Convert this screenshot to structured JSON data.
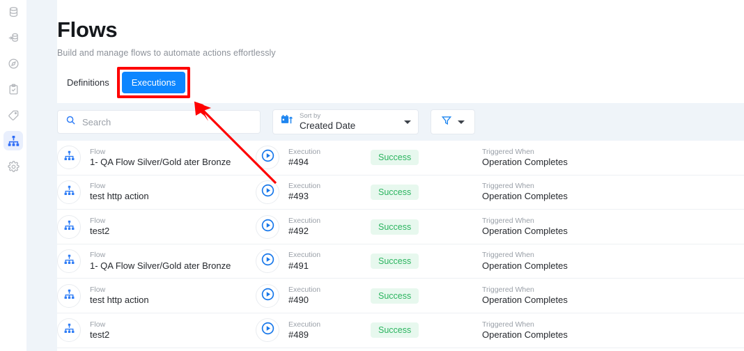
{
  "sidebar": {
    "items": [
      {
        "name": "database-icon",
        "label": "Database",
        "active": false
      },
      {
        "name": "database-import-icon",
        "label": "Import Data",
        "active": false
      },
      {
        "name": "compass-icon",
        "label": "Explore",
        "active": false
      },
      {
        "name": "clipboard-check-icon",
        "label": "Tasks",
        "active": false
      },
      {
        "name": "tag-icon",
        "label": "Tags",
        "active": false
      },
      {
        "name": "flows-icon",
        "label": "Flows",
        "active": true
      },
      {
        "name": "gear-icon",
        "label": "Settings",
        "active": false
      }
    ]
  },
  "header": {
    "title": "Flows",
    "subtitle": "Build and manage flows to automate actions effortlessly"
  },
  "tabs": [
    {
      "label": "Definitions",
      "active": false
    },
    {
      "label": "Executions",
      "active": true
    }
  ],
  "toolbar": {
    "search_placeholder": "Search",
    "search_value": "",
    "sort_label": "Sort by",
    "sort_value": "Created Date",
    "filter_label": ""
  },
  "labels": {
    "flow": "Flow",
    "execution": "Execution",
    "triggered_when": "Triggered When"
  },
  "rows": [
    {
      "flow": "1- QA Flow Silver/Gold ater Bronze",
      "execution": "#494",
      "status": "Success",
      "trigger": "Operation Completes"
    },
    {
      "flow": "test http action",
      "execution": "#493",
      "status": "Success",
      "trigger": "Operation Completes"
    },
    {
      "flow": "test2",
      "execution": "#492",
      "status": "Success",
      "trigger": "Operation Completes"
    },
    {
      "flow": "1- QA Flow Silver/Gold ater Bronze",
      "execution": "#491",
      "status": "Success",
      "trigger": "Operation Completes"
    },
    {
      "flow": "test http action",
      "execution": "#490",
      "status": "Success",
      "trigger": "Operation Completes"
    },
    {
      "flow": "test2",
      "execution": "#489",
      "status": "Success",
      "trigger": "Operation Completes"
    }
  ],
  "annotation": {
    "color": "#fe0000",
    "shape": "arrow-and-box",
    "target": "Executions"
  },
  "colors": {
    "accent_blue": "#0d86ff",
    "icon_blue": "#2f7df6",
    "status_green": "#2bb45f",
    "status_green_bg": "#e7f8ee",
    "toolbar_bg": "#eff4f9",
    "annotation_red": "#fe0000"
  }
}
